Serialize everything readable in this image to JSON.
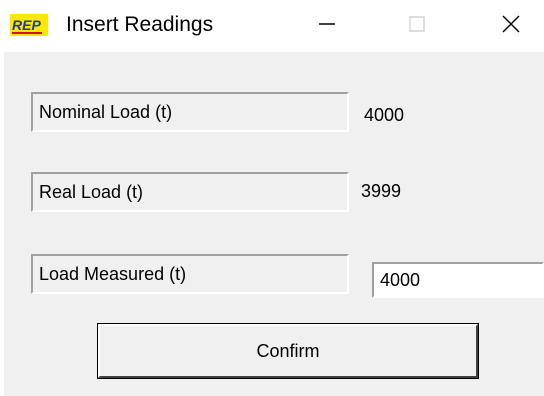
{
  "window": {
    "title": "Insert Readings",
    "icon": "app-logo-icon",
    "controls": {
      "minimize": "minimize-icon",
      "maximize": "maximize-icon",
      "close": "close-icon"
    }
  },
  "form": {
    "nominal_load": {
      "label": "Nominal Load (t)",
      "value": "4000"
    },
    "real_load": {
      "label": "Real Load (t)",
      "value": "3999"
    },
    "load_measured": {
      "label": "Load Measured (t)",
      "input_value": "4000"
    },
    "confirm_label": "Confirm"
  },
  "colors": {
    "client_bg": "#f0f0f0",
    "icon_yellow": "#ffe800",
    "icon_red": "#d41010",
    "icon_blue": "#1a3fa0"
  }
}
